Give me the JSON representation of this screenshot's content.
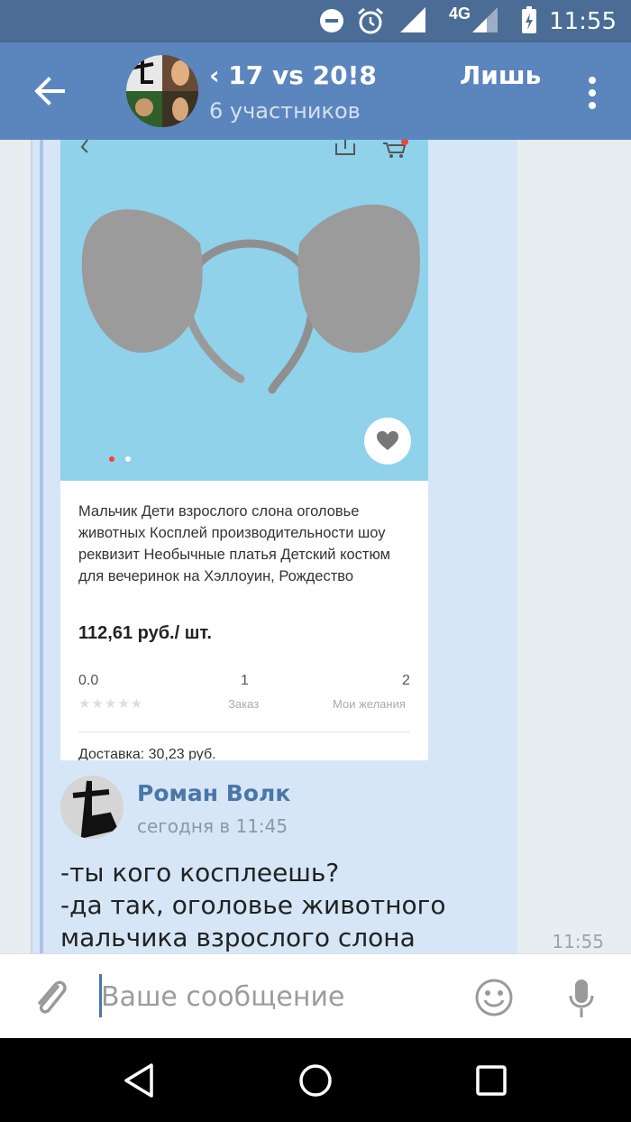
{
  "status_bar": {
    "time": "11:55",
    "network": "4G",
    "icons": [
      "do-not-disturb-icon",
      "alarm-icon",
      "signal-icon",
      "signal-icon",
      "battery-icon"
    ]
  },
  "header": {
    "title": "‹ 17 vs 20!8",
    "subtitle": "6 участников",
    "action_label": "Лишь",
    "icons": [
      "back-arrow-icon",
      "more-vertical-icon"
    ]
  },
  "attachment": {
    "product_title": "Мальчик Дети взрослого слона оголовье животных Косплей производительности шоу реквизит Необычные платья Детский костюм для вечеринок на Хэллоуин, Рождество",
    "price": "112,61 руб./ шт.",
    "rating_value": "0.0",
    "stars": "★★★★★",
    "orders_count": "1",
    "orders_label": "Заказ",
    "wishlist_count": "2",
    "wishlist_label": "Мои желания",
    "delivery": "Доставка: 30,23 руб.",
    "icons": [
      "chevron-left-icon",
      "share-icon",
      "cart-icon",
      "heart-icon"
    ],
    "colors": {
      "image_bg": "#8fd2ea",
      "accent_dot": "#f44336"
    }
  },
  "message": {
    "author": "Роман Волк",
    "time": "сегодня в 11:45",
    "text_line1": "-ты кого косплеешь?",
    "text_line2": "-да так, оголовье животного",
    "text_line3": "мальчика взрослого слона",
    "sent_time": "11:55"
  },
  "composer": {
    "placeholder": "Ваше сообщение",
    "icons": [
      "paperclip-icon",
      "emoji-icon",
      "microphone-icon"
    ]
  },
  "nav": {
    "icons": [
      "back-triangle-icon",
      "home-circle-icon",
      "recents-square-icon"
    ]
  },
  "colors": {
    "header_bg": "#5b85bd",
    "status_bg": "#4a6c95",
    "bubble_bg": "#d6e6f7",
    "author_name": "#4a76a8"
  }
}
